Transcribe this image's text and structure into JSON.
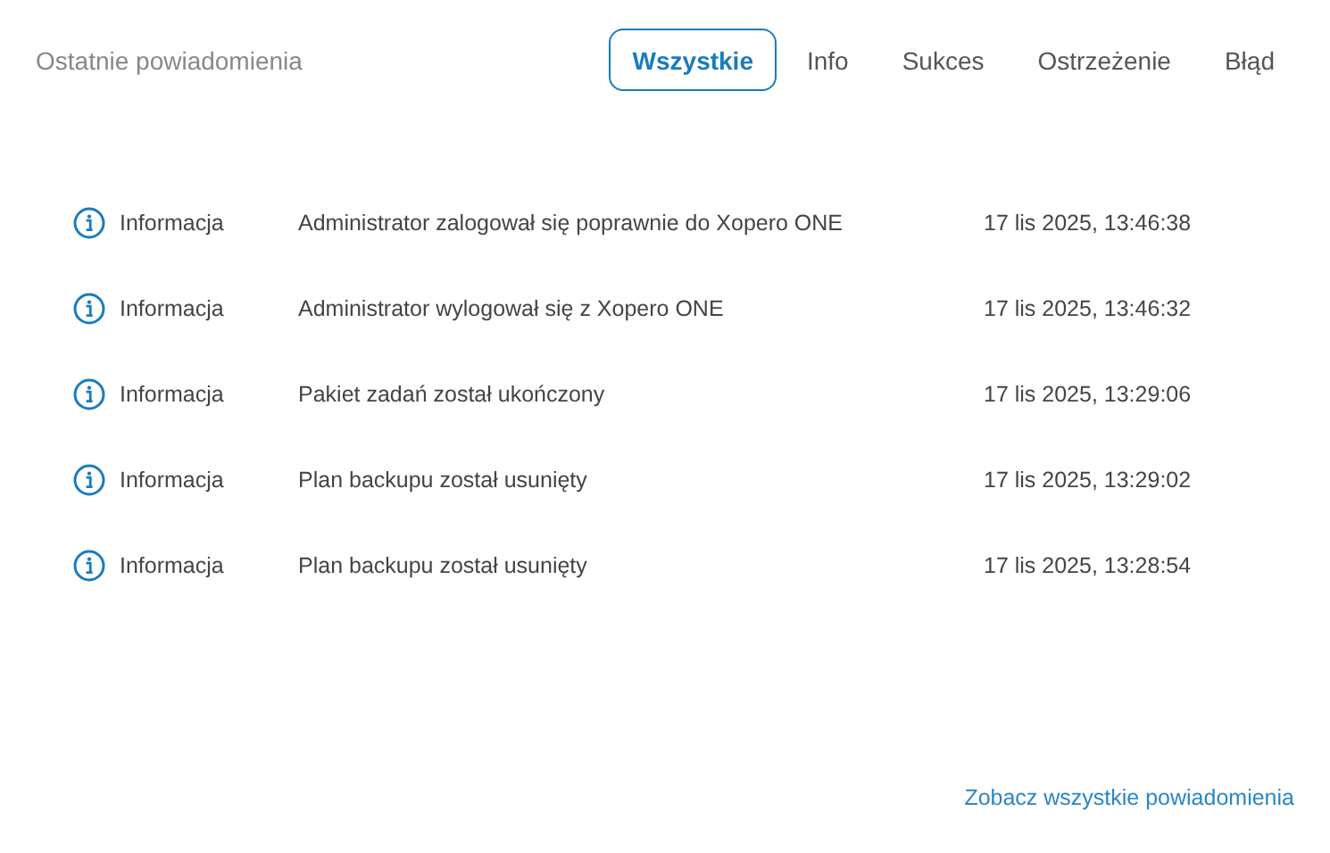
{
  "header": {
    "title": "Ostatnie powiadomienia"
  },
  "tabs": [
    {
      "label": "Wszystkie",
      "selected": true
    },
    {
      "label": "Info",
      "selected": false
    },
    {
      "label": "Sukces",
      "selected": false
    },
    {
      "label": "Ostrzeżenie",
      "selected": false
    },
    {
      "label": "Błąd",
      "selected": false
    }
  ],
  "notifications": [
    {
      "kind": "info",
      "type": "Informacja",
      "message": "Administrator zalogował się poprawnie do Xopero ONE",
      "time": "17 lis 2025, 13:46:38"
    },
    {
      "kind": "info",
      "type": "Informacja",
      "message": "Administrator wylogował się z Xopero ONE",
      "time": "17 lis 2025, 13:46:32"
    },
    {
      "kind": "info",
      "type": "Informacja",
      "message": "Pakiet zadań został ukończony",
      "time": "17 lis 2025, 13:29:06"
    },
    {
      "kind": "info",
      "type": "Informacja",
      "message": "Plan backupu został usunięty",
      "time": "17 lis 2025, 13:29:02"
    },
    {
      "kind": "info",
      "type": "Informacja",
      "message": "Plan backupu został usunięty",
      "time": "17 lis 2025, 13:28:54"
    }
  ],
  "footer_link": "Zobacz wszystkie powiadomienia"
}
